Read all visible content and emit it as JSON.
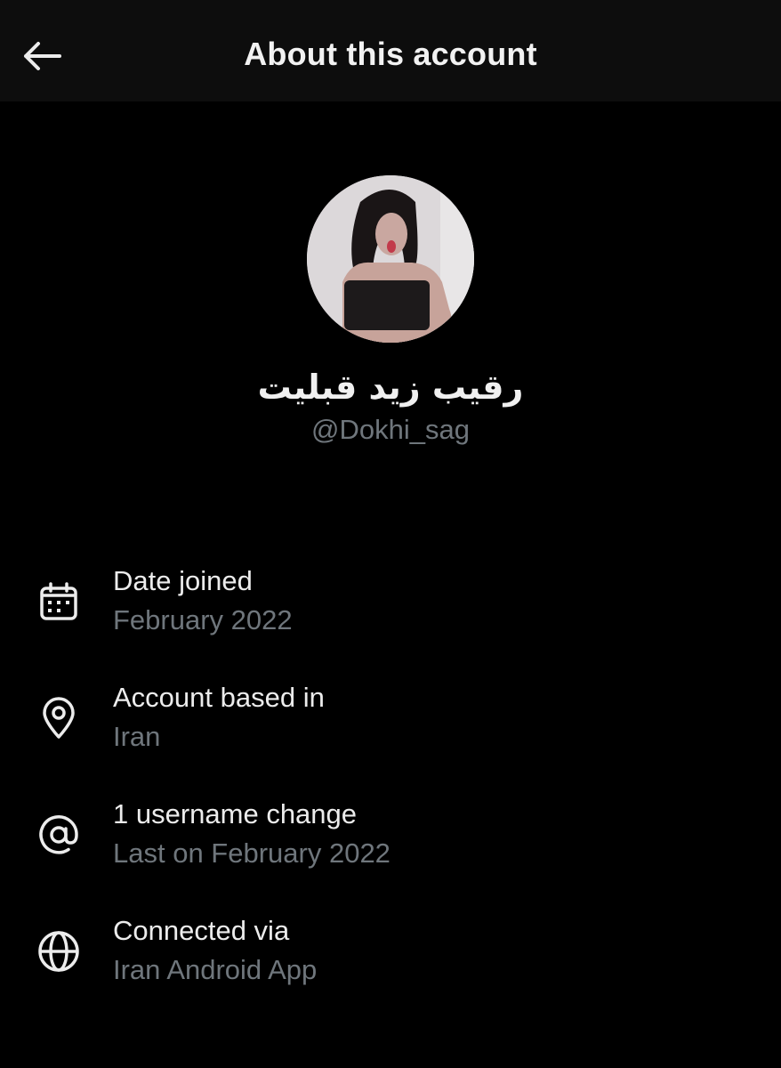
{
  "header": {
    "title": "About this account",
    "back_icon": "arrow-left-icon"
  },
  "profile": {
    "display_name": "رقيب زيد قبليت",
    "handle": "@Dokhi_sag"
  },
  "details": [
    {
      "icon": "calendar-icon",
      "title": "Date joined",
      "subtitle": "February 2022"
    },
    {
      "icon": "location-pin-icon",
      "title": "Account based in",
      "subtitle": "Iran"
    },
    {
      "icon": "at-sign-icon",
      "title": "1 username change",
      "subtitle": "Last on February 2022"
    },
    {
      "icon": "globe-icon",
      "title": "Connected via",
      "subtitle": "Iran Android App"
    }
  ],
  "colors": {
    "background": "#000000",
    "header_background": "#0d0d0d",
    "primary_text": "#e7e9ea",
    "secondary_text": "#6f767c"
  }
}
